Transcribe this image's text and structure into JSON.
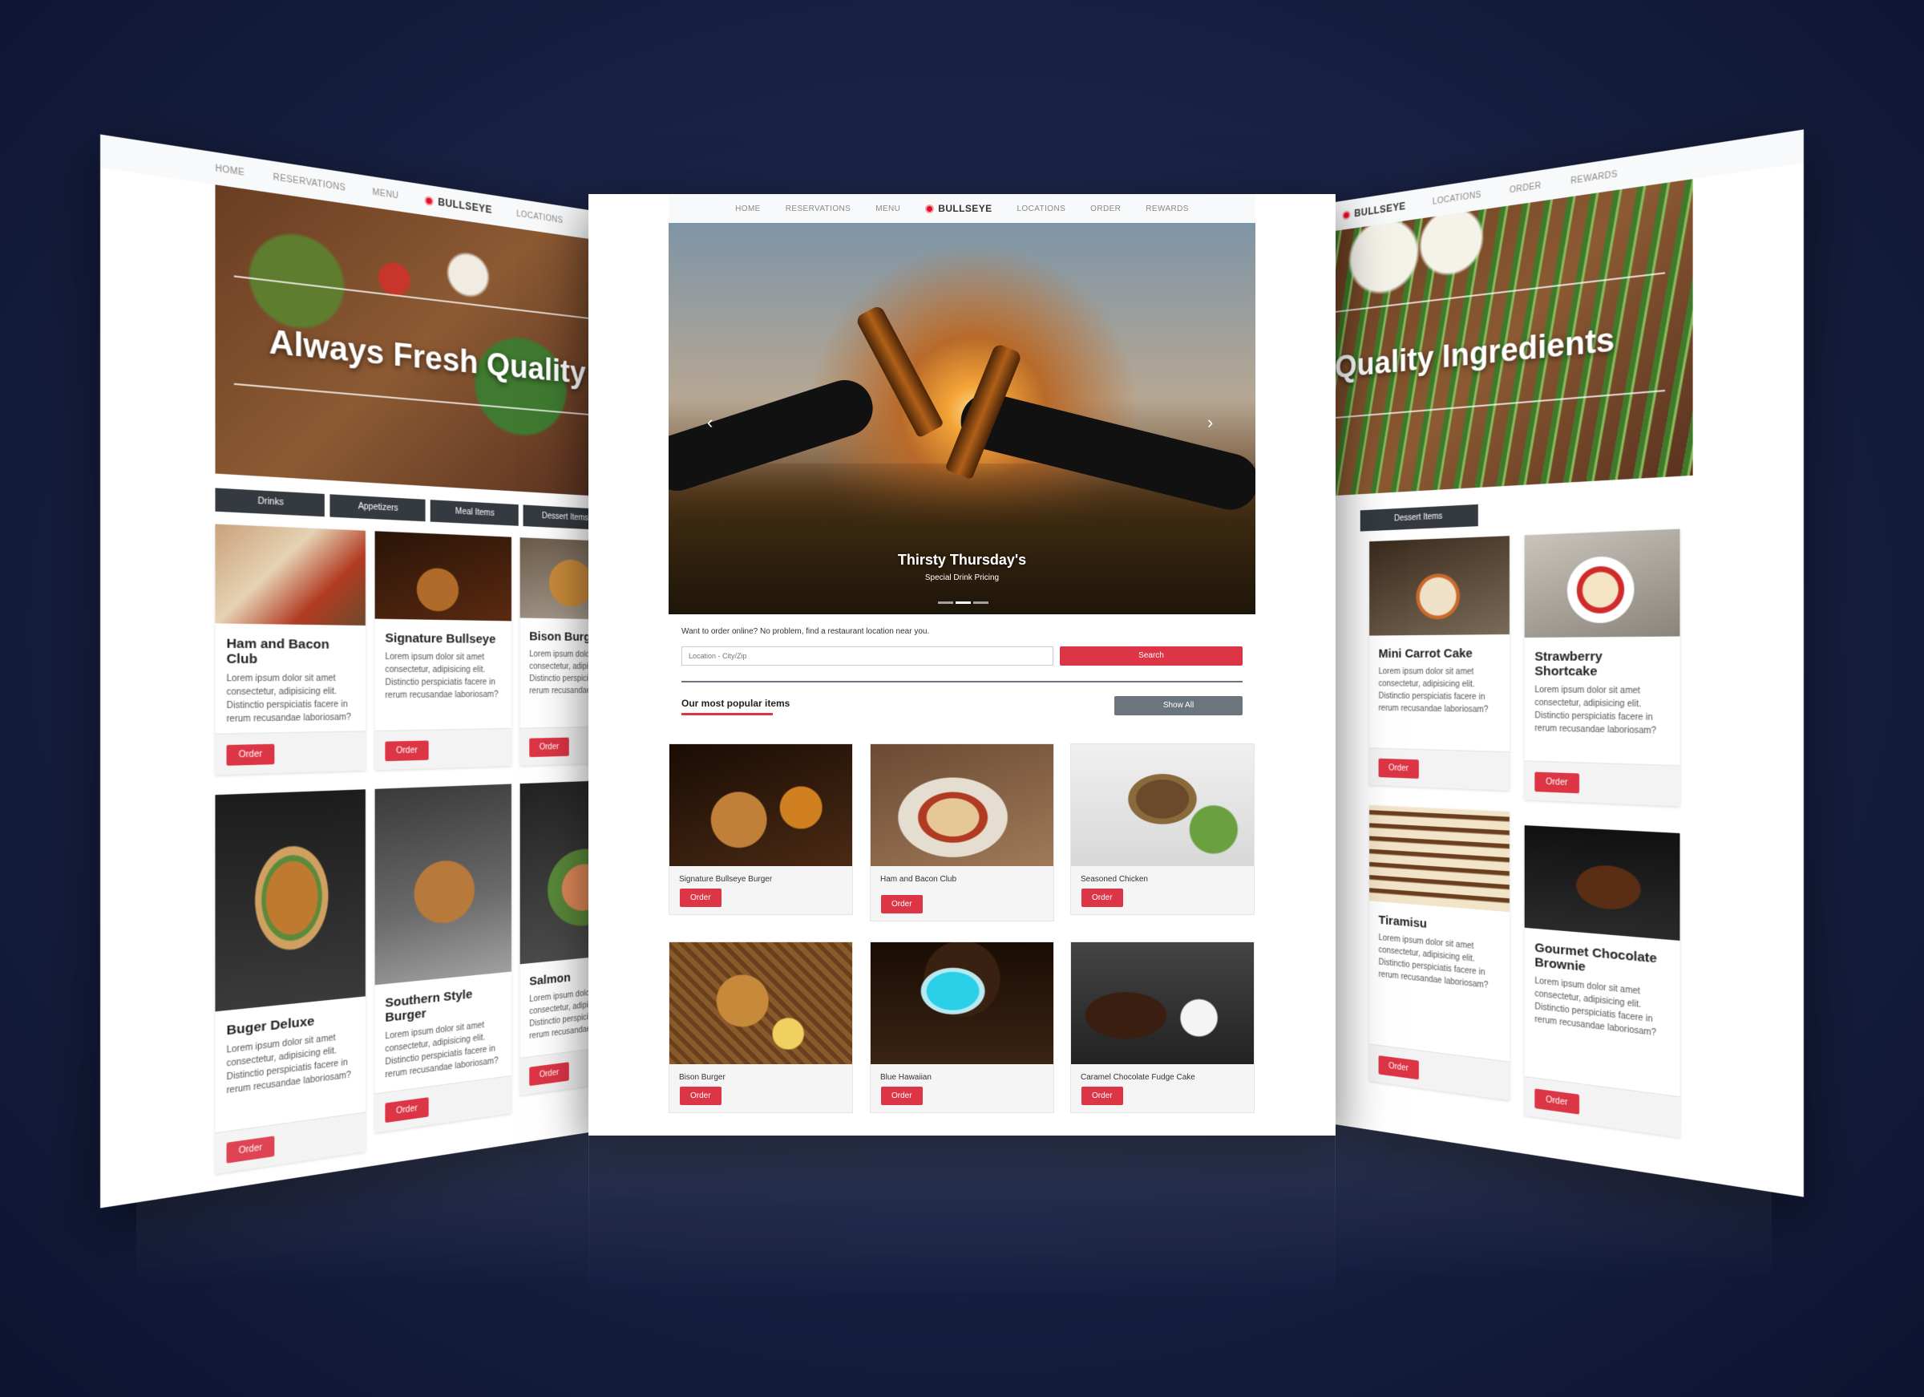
{
  "nav": {
    "home": "HOME",
    "reservations": "RESERVATIONS",
    "menu": "MENU",
    "brand": "BULLSEYE",
    "locations": "LOCATIONS",
    "order": "ORDER",
    "rewards": "REWARDS"
  },
  "left": {
    "hero_text": "Always Fresh Quality Ingredients",
    "tabs": [
      "Drinks",
      "Appetizers",
      "Meal Items",
      "Dessert Items"
    ],
    "cards": [
      {
        "title": "Ham and Bacon Club",
        "desc": "Lorem ipsum dolor sit amet consectetur, adipisicing elit. Distinctio perspiciatis facere in rerum recusandae laboriosam?",
        "button": "Order"
      },
      {
        "title": "Signature Bullseye",
        "desc": "Lorem ipsum dolor sit amet consectetur, adipisicing elit. Distinctio perspiciatis facere in rerum recusandae laboriosam?",
        "button": "Order"
      },
      {
        "title": "Bison Burger",
        "desc": "Lorem ipsum dolor sit amet consectetur, adipisicing elit. Distinctio perspiciatis facere in rerum recusandae laboriosam?",
        "button": "Order"
      },
      {
        "title": "Buger Deluxe",
        "desc": "Lorem ipsum dolor sit amet consectetur, adipisicing elit. Distinctio perspiciatis facere in rerum recusandae laboriosam?",
        "button": "Order"
      },
      {
        "title": "Southern Style Burger",
        "desc": "Lorem ipsum dolor sit amet consectetur, adipisicing elit. Distinctio perspiciatis facere in rerum recusandae laboriosam?",
        "button": "Order"
      },
      {
        "title": "Salmon",
        "desc": "Lorem ipsum dolor sit amet consectetur, adipisicing elit. Distinctio perspiciatis facere in rerum recusandae laboriosam?",
        "button": "Order"
      }
    ]
  },
  "center": {
    "hero_caption": "Thirsty Thursday's",
    "hero_subcaption": "Special Drink Pricing",
    "order_prompt": "Want to order online? No problem, find a restaurant location near you.",
    "location_placeholder": "Location - City/Zip",
    "search_button": "Search",
    "popular_heading": "Our most popular items",
    "show_all": "Show All",
    "items": [
      {
        "name": "Signature Bullseye Burger",
        "button": "Order"
      },
      {
        "name": "Ham and Bacon Club",
        "button": "Order"
      },
      {
        "name": "Seasoned Chicken",
        "button": "Order"
      },
      {
        "name": "Bison Burger",
        "button": "Order"
      },
      {
        "name": "Blue Hawaiian",
        "button": "Order"
      },
      {
        "name": "Caramel Chocolate Fudge Cake",
        "button": "Order"
      }
    ]
  },
  "right": {
    "hero_text": "Quality Ingredients",
    "tab": "Dessert Items",
    "cards": [
      {
        "title": "Mini Carrot Cake",
        "desc": "Lorem ipsum dolor sit amet consectetur, adipisicing elit. Distinctio perspiciatis facere in rerum recusandae laboriosam?",
        "button": "Order"
      },
      {
        "title": "Strawberry Shortcake",
        "desc": "Lorem ipsum dolor sit amet consectetur, adipisicing elit. Distinctio perspiciatis facere in rerum recusandae laboriosam?",
        "button": "Order"
      },
      {
        "title": "Tiramisu",
        "desc": "Lorem ipsum dolor sit amet consectetur, adipisicing elit. Distinctio perspiciatis facere in rerum recusandae laboriosam?",
        "button": "Order"
      },
      {
        "title": "Gourmet Chocolate Brownie",
        "desc": "Lorem ipsum dolor sit amet consectetur, adipisicing elit. Distinctio perspiciatis facere in rerum recusandae laboriosam?",
        "button": "Order"
      }
    ]
  },
  "colors": {
    "accent": "#dc3545",
    "dark": "#343a40",
    "background": "#141c3a"
  }
}
